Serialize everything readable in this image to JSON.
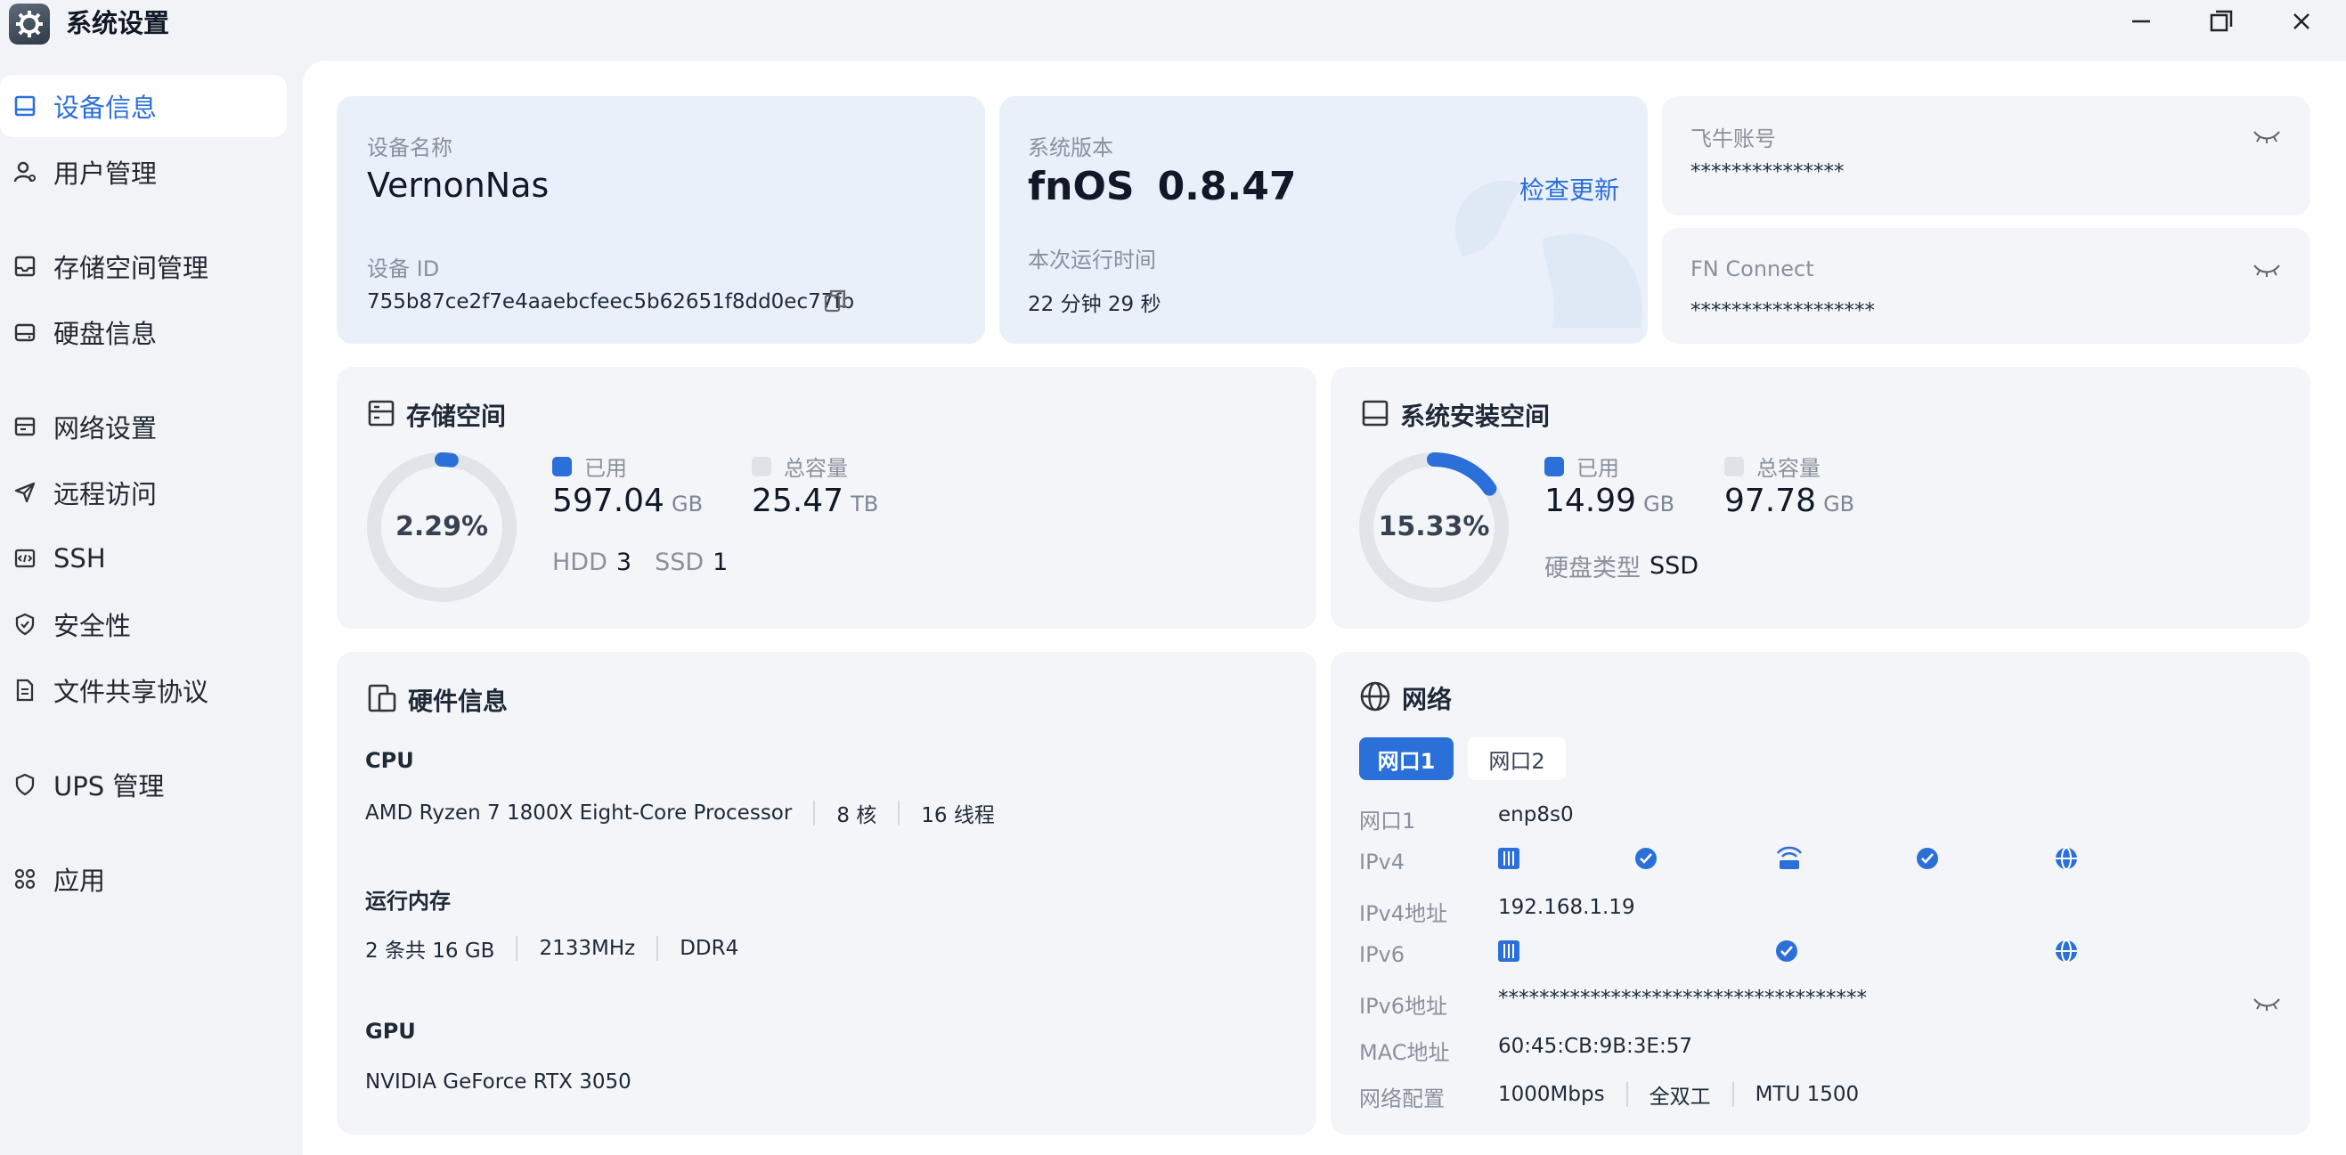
{
  "window": {
    "title": "系统设置"
  },
  "sidebar": {
    "items": [
      {
        "label": "设备信息"
      },
      {
        "label": "用户管理"
      },
      {
        "label": "存储空间管理"
      },
      {
        "label": "硬盘信息"
      },
      {
        "label": "网络设置"
      },
      {
        "label": "远程访问"
      },
      {
        "label": "SSH"
      },
      {
        "label": "安全性"
      },
      {
        "label": "文件共享协议"
      },
      {
        "label": "UPS 管理"
      },
      {
        "label": "应用"
      }
    ]
  },
  "device": {
    "name_label": "设备名称",
    "name": "VernonNas",
    "id_label": "设备 ID",
    "id": "755b87ce2f7e4aaebcfeec5b62651f8dd0ec77fb"
  },
  "system": {
    "version_label": "系统版本",
    "os_name": "fnOS",
    "version": "0.8.47",
    "check_update": "检查更新",
    "uptime_label": "本次运行时间",
    "uptime": "22 分钟 29 秒"
  },
  "account": {
    "label": "飞牛账号",
    "value": "***************",
    "fn_label": "FN Connect",
    "fn_value": "******************"
  },
  "storage": {
    "title": "存储空间",
    "percent": "2.29%",
    "fraction": 0.0229,
    "used_label": "已用",
    "used_value": "597.04",
    "used_unit": "GB",
    "total_label": "总容量",
    "total_value": "25.47",
    "total_unit": "TB",
    "hdd_label": "HDD",
    "hdd_count": "3",
    "ssd_label": "SSD",
    "ssd_count": "1"
  },
  "sysdisk": {
    "title": "系统安装空间",
    "percent": "15.33%",
    "fraction": 0.1533,
    "used_label": "已用",
    "used_value": "14.99",
    "used_unit": "GB",
    "total_label": "总容量",
    "total_value": "97.78",
    "total_unit": "GB",
    "type_label": "硬盘类型",
    "type_value": "SSD"
  },
  "hardware": {
    "title": "硬件信息",
    "cpu_label": "CPU",
    "cpu_model": "AMD Ryzen 7 1800X Eight-Core Processor",
    "cpu_cores": "8 核",
    "cpu_threads": "16 线程",
    "mem_label": "运行内存",
    "mem_size": "2 条共 16 GB",
    "mem_speed": "2133MHz",
    "mem_type": "DDR4",
    "gpu_label": "GPU",
    "gpu_model": "NVIDIA GeForce RTX 3050"
  },
  "network": {
    "title": "网络",
    "tabs": [
      "网口1",
      "网口2"
    ],
    "rows": {
      "port_label": "网口1",
      "port_value": "enp8s0",
      "ipv4_label": "IPv4",
      "ipv4_addr_label": "IPv4地址",
      "ipv4_addr": "192.168.1.19",
      "ipv6_label": "IPv6",
      "ipv6_addr_label": "IPv6地址",
      "ipv6_addr": "************************************",
      "mac_label": "MAC地址",
      "mac": "60:45:CB:9B:3E:57",
      "config_label": "网络配置",
      "speed": "1000Mbps",
      "duplex": "全双工",
      "mtu": "MTU 1500"
    }
  },
  "colors": {
    "accent": "#2b6fd8",
    "ring_bg": "#e1e4e9",
    "card_bg": "#f3f5f8"
  }
}
